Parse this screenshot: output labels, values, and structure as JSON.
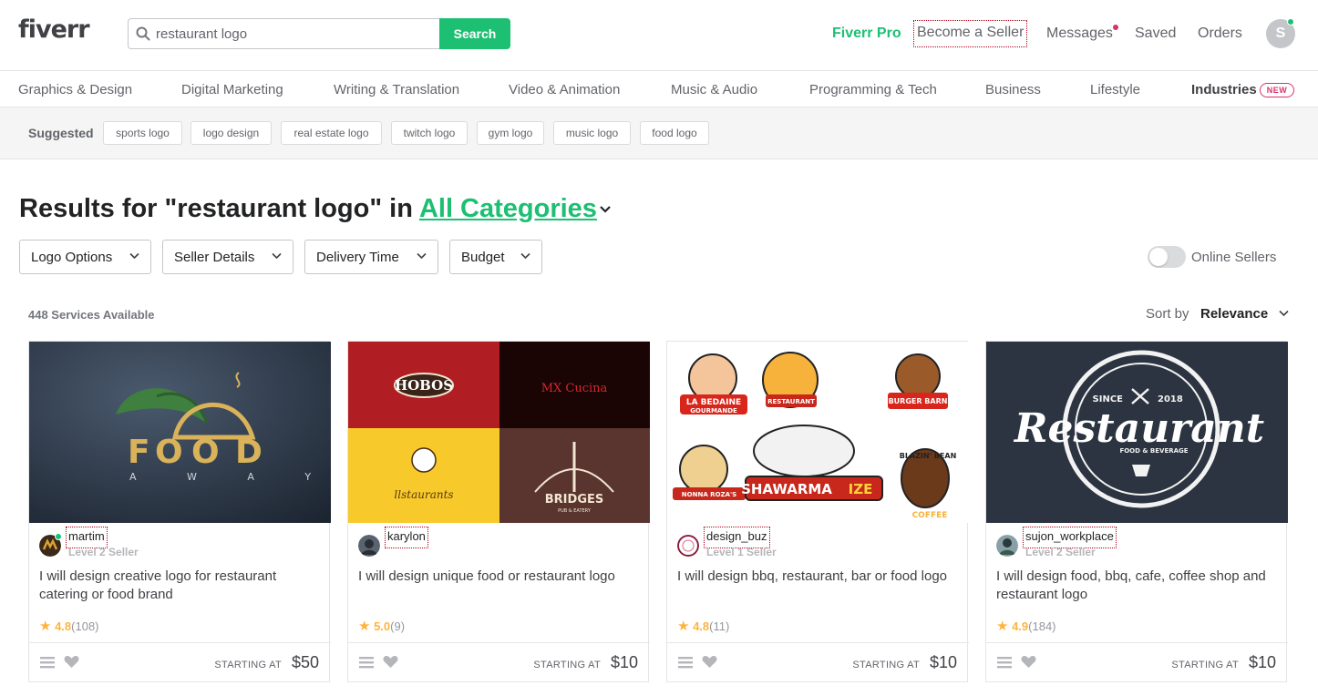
{
  "header": {
    "logo": "fiverr",
    "search_value": "restaurant logo",
    "search_button": "Search",
    "fiverr_pro": "Fiverr Pro",
    "become_seller": "Become a Seller",
    "messages": "Messages",
    "saved": "Saved",
    "orders": "Orders",
    "avatar_initial": "S"
  },
  "categories": [
    "Graphics & Design",
    "Digital Marketing",
    "Writing & Translation",
    "Video & Animation",
    "Music & Audio",
    "Programming & Tech",
    "Business",
    "Lifestyle",
    "Industries"
  ],
  "new_badge": "NEW",
  "suggested": {
    "label": "Suggested",
    "chips": [
      "sports logo",
      "logo design",
      "real estate logo",
      "twitch logo",
      "gym logo",
      "music logo",
      "food logo"
    ]
  },
  "results": {
    "prefix": "Results for \"restaurant logo\" in ",
    "category": "All Categories"
  },
  "filters": [
    "Logo Options",
    "Seller Details",
    "Delivery Time",
    "Budget"
  ],
  "online_sellers": "Online Sellers",
  "services_count": "448 Services Available",
  "sort": {
    "label": "Sort by",
    "value": "Relevance"
  },
  "cards": [
    {
      "seller": "martim",
      "level": "Level 2 Seller",
      "title": "I will design creative logo for restaurant catering or food brand",
      "score": "4.8",
      "count": "(108)",
      "starting": "STARTING AT",
      "price": "$50",
      "image_text": [
        "F",
        "O",
        "O",
        "D",
        "A W A Y"
      ]
    },
    {
      "seller": "karylon",
      "level": "",
      "title": "I will design unique food or restaurant logo",
      "score": "5.0",
      "count": "(9)",
      "starting": "STARTING AT",
      "price": "$10",
      "image_text": [
        "HOBOS",
        "MX Cucina",
        "llstaurants",
        "BRIDGES",
        "PUB & EATERY"
      ]
    },
    {
      "seller": "design_buz",
      "level": "Level 1 Seller",
      "title": "I will design bbq, restaurant, bar or food logo",
      "score": "4.8",
      "count": "(11)",
      "starting": "STARTING AT",
      "price": "$10",
      "image_text": [
        "LA BEDAINE",
        "GOURMANDE",
        "RESTAURANT",
        "BURGER BARN",
        "NONNA ROZA'S",
        "SHAWARMA",
        "IZE",
        "BLAZIN' BEAN",
        "COFFEE"
      ]
    },
    {
      "seller": "sujon_workplace",
      "level": "Level 2 Seller",
      "title": "I will design food, bbq, cafe, coffee shop and restaurant logo",
      "score": "4.9",
      "count": "(184)",
      "starting": "STARTING AT",
      "price": "$10",
      "image_text": [
        "SINCE",
        "2018",
        "Restaurant",
        "FOOD & BEVERAGE"
      ]
    }
  ],
  "colors": {
    "brand_green": "#1dbf73",
    "star": "#ffb33e",
    "new_pink": "#d6336c"
  }
}
